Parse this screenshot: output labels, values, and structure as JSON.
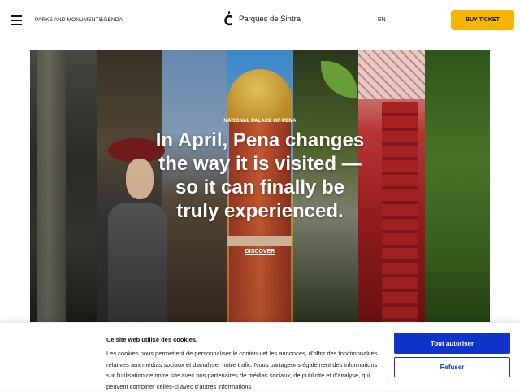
{
  "header": {
    "nav": [
      "PARKS AND MONUMENTS",
      "AGENDA"
    ],
    "logo_text": "Parques de Sintra",
    "language": "EN",
    "ticket_label": "BUY TICKET"
  },
  "hero": {
    "eyebrow": "NATIONAL PALACE OF PENA",
    "headline": "In April, Pena changes the way it is visited — so it can finally be truly experienced.",
    "cta": "DISCOVER"
  },
  "cookie": {
    "title": "Ce site web utilise des cookies.",
    "body": "Les cookies nous permettent de personnaliser le contenu et les annonces, d'offrir des fonctionnalités relatives aux médias sociaux et d'analyser notre trafic. Nous partageons également des informations sur l'utilisation de notre site avec nos partenaires de médias sociaux, de publicité et d'analyse, qui peuvent combiner celles-ci avec d'autres informations",
    "allow_label": "Tout autoriser",
    "refuse_label": "Refuser"
  },
  "colors": {
    "accent": "#f5b400",
    "primary_blue": "#1233c9"
  },
  "icons": {
    "menu": "hamburger-icon",
    "logo": "sintra-logo-icon"
  }
}
